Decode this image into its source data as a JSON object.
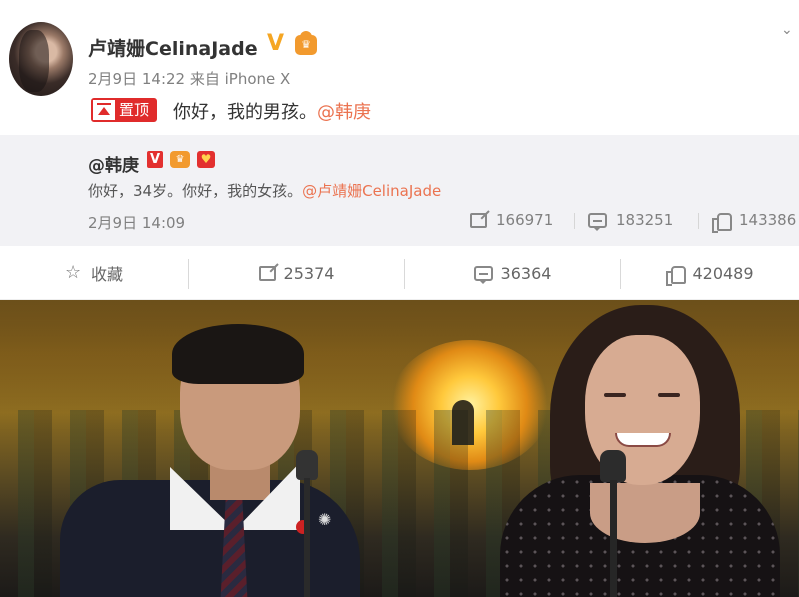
{
  "post": {
    "username": "卢靖姗CelinaJade",
    "verified_icon": "v-verified-icon",
    "vip_icon": "vip-crown-icon",
    "timestamp": "2月9日 14:22 来自 iPhone X",
    "pinned_label": "置顶",
    "text": "你好，我的男孩。",
    "mention": "@韩庚"
  },
  "retweet": {
    "username": "@韩庚",
    "text": "你好，34岁。你好，我的女孩。",
    "mention": "@卢靖姗CelinaJade",
    "date": "2月9日 14:09",
    "reposts": "166971",
    "comments": "183251",
    "likes": "143386"
  },
  "actions": {
    "favorite_label": "收藏",
    "reposts": "25374",
    "comments": "36364",
    "likes": "420489"
  },
  "colors": {
    "mention": "#eb7350",
    "pin_red": "#e02b2b",
    "verified_gold": "#f5a623",
    "retweet_bg": "#f2f2f5"
  }
}
